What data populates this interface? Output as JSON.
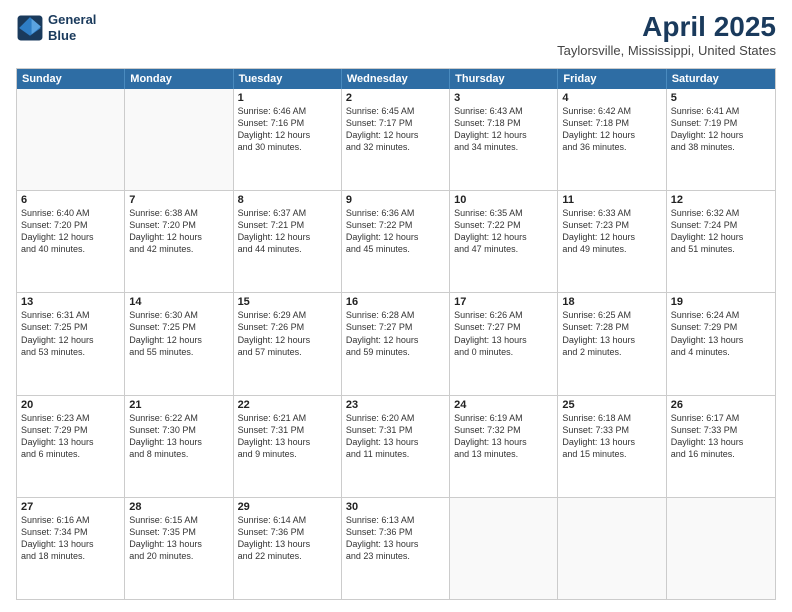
{
  "header": {
    "logo_line1": "General",
    "logo_line2": "Blue",
    "month": "April 2025",
    "location": "Taylorsville, Mississippi, United States"
  },
  "weekdays": [
    "Sunday",
    "Monday",
    "Tuesday",
    "Wednesday",
    "Thursday",
    "Friday",
    "Saturday"
  ],
  "rows": [
    [
      {
        "day": "",
        "info": ""
      },
      {
        "day": "",
        "info": ""
      },
      {
        "day": "1",
        "info": "Sunrise: 6:46 AM\nSunset: 7:16 PM\nDaylight: 12 hours\nand 30 minutes."
      },
      {
        "day": "2",
        "info": "Sunrise: 6:45 AM\nSunset: 7:17 PM\nDaylight: 12 hours\nand 32 minutes."
      },
      {
        "day": "3",
        "info": "Sunrise: 6:43 AM\nSunset: 7:18 PM\nDaylight: 12 hours\nand 34 minutes."
      },
      {
        "day": "4",
        "info": "Sunrise: 6:42 AM\nSunset: 7:18 PM\nDaylight: 12 hours\nand 36 minutes."
      },
      {
        "day": "5",
        "info": "Sunrise: 6:41 AM\nSunset: 7:19 PM\nDaylight: 12 hours\nand 38 minutes."
      }
    ],
    [
      {
        "day": "6",
        "info": "Sunrise: 6:40 AM\nSunset: 7:20 PM\nDaylight: 12 hours\nand 40 minutes."
      },
      {
        "day": "7",
        "info": "Sunrise: 6:38 AM\nSunset: 7:20 PM\nDaylight: 12 hours\nand 42 minutes."
      },
      {
        "day": "8",
        "info": "Sunrise: 6:37 AM\nSunset: 7:21 PM\nDaylight: 12 hours\nand 44 minutes."
      },
      {
        "day": "9",
        "info": "Sunrise: 6:36 AM\nSunset: 7:22 PM\nDaylight: 12 hours\nand 45 minutes."
      },
      {
        "day": "10",
        "info": "Sunrise: 6:35 AM\nSunset: 7:22 PM\nDaylight: 12 hours\nand 47 minutes."
      },
      {
        "day": "11",
        "info": "Sunrise: 6:33 AM\nSunset: 7:23 PM\nDaylight: 12 hours\nand 49 minutes."
      },
      {
        "day": "12",
        "info": "Sunrise: 6:32 AM\nSunset: 7:24 PM\nDaylight: 12 hours\nand 51 minutes."
      }
    ],
    [
      {
        "day": "13",
        "info": "Sunrise: 6:31 AM\nSunset: 7:25 PM\nDaylight: 12 hours\nand 53 minutes."
      },
      {
        "day": "14",
        "info": "Sunrise: 6:30 AM\nSunset: 7:25 PM\nDaylight: 12 hours\nand 55 minutes."
      },
      {
        "day": "15",
        "info": "Sunrise: 6:29 AM\nSunset: 7:26 PM\nDaylight: 12 hours\nand 57 minutes."
      },
      {
        "day": "16",
        "info": "Sunrise: 6:28 AM\nSunset: 7:27 PM\nDaylight: 12 hours\nand 59 minutes."
      },
      {
        "day": "17",
        "info": "Sunrise: 6:26 AM\nSunset: 7:27 PM\nDaylight: 13 hours\nand 0 minutes."
      },
      {
        "day": "18",
        "info": "Sunrise: 6:25 AM\nSunset: 7:28 PM\nDaylight: 13 hours\nand 2 minutes."
      },
      {
        "day": "19",
        "info": "Sunrise: 6:24 AM\nSunset: 7:29 PM\nDaylight: 13 hours\nand 4 minutes."
      }
    ],
    [
      {
        "day": "20",
        "info": "Sunrise: 6:23 AM\nSunset: 7:29 PM\nDaylight: 13 hours\nand 6 minutes."
      },
      {
        "day": "21",
        "info": "Sunrise: 6:22 AM\nSunset: 7:30 PM\nDaylight: 13 hours\nand 8 minutes."
      },
      {
        "day": "22",
        "info": "Sunrise: 6:21 AM\nSunset: 7:31 PM\nDaylight: 13 hours\nand 9 minutes."
      },
      {
        "day": "23",
        "info": "Sunrise: 6:20 AM\nSunset: 7:31 PM\nDaylight: 13 hours\nand 11 minutes."
      },
      {
        "day": "24",
        "info": "Sunrise: 6:19 AM\nSunset: 7:32 PM\nDaylight: 13 hours\nand 13 minutes."
      },
      {
        "day": "25",
        "info": "Sunrise: 6:18 AM\nSunset: 7:33 PM\nDaylight: 13 hours\nand 15 minutes."
      },
      {
        "day": "26",
        "info": "Sunrise: 6:17 AM\nSunset: 7:33 PM\nDaylight: 13 hours\nand 16 minutes."
      }
    ],
    [
      {
        "day": "27",
        "info": "Sunrise: 6:16 AM\nSunset: 7:34 PM\nDaylight: 13 hours\nand 18 minutes."
      },
      {
        "day": "28",
        "info": "Sunrise: 6:15 AM\nSunset: 7:35 PM\nDaylight: 13 hours\nand 20 minutes."
      },
      {
        "day": "29",
        "info": "Sunrise: 6:14 AM\nSunset: 7:36 PM\nDaylight: 13 hours\nand 22 minutes."
      },
      {
        "day": "30",
        "info": "Sunrise: 6:13 AM\nSunset: 7:36 PM\nDaylight: 13 hours\nand 23 minutes."
      },
      {
        "day": "",
        "info": ""
      },
      {
        "day": "",
        "info": ""
      },
      {
        "day": "",
        "info": ""
      }
    ]
  ]
}
